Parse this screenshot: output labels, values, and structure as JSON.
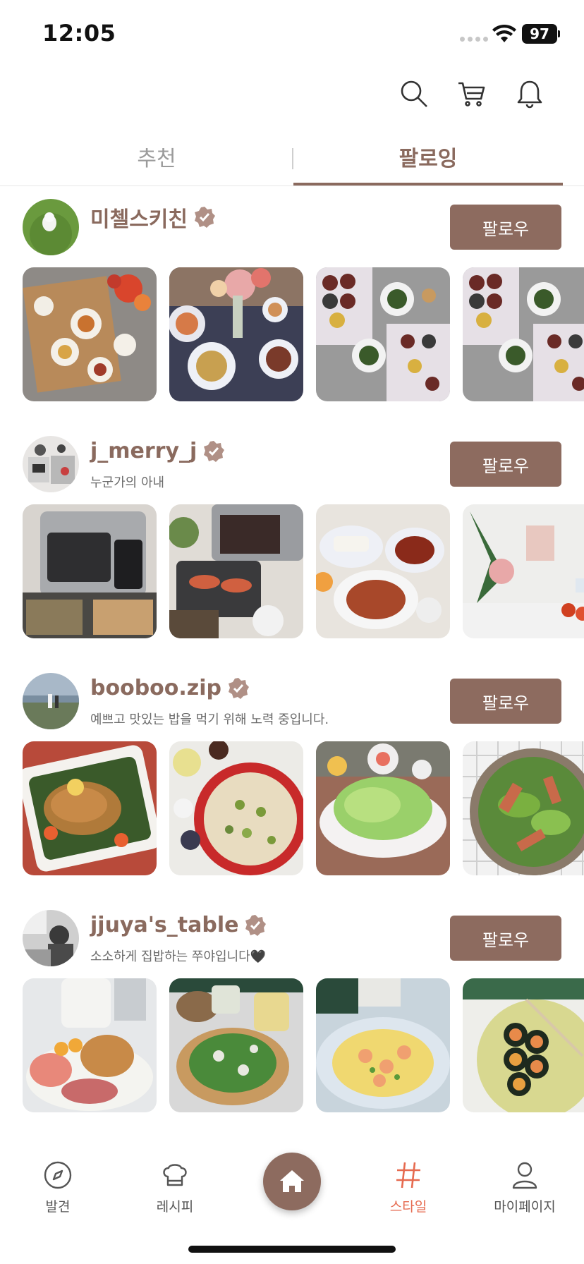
{
  "status": {
    "time": "12:05",
    "battery": "97"
  },
  "tabs": {
    "recommend": "추천",
    "following": "팔로잉"
  },
  "creators": [
    {
      "name": "미첼스키친",
      "bio": "",
      "follow_label": "팔로우"
    },
    {
      "name": "j_merry_j",
      "bio": "누군가의 아내",
      "follow_label": "팔로우"
    },
    {
      "name": "booboo.zip",
      "bio": "예쁘고 맛있는 밥을 먹기 위해 노력 중입니다.",
      "follow_label": "팔로우"
    },
    {
      "name": "jjuya's_table",
      "bio": "소소하게 집밥하는 쭈야입니다🖤",
      "follow_label": "팔로우"
    }
  ],
  "nav": {
    "discover": "발견",
    "recipe": "레시피",
    "style": "스타일",
    "mypage": "마이페이지"
  },
  "colors": {
    "accent": "#8d6b5f",
    "active_nav": "#e66a4f"
  },
  "icons": [
    "search-icon",
    "cart-icon",
    "bell-icon",
    "verified-icon",
    "compass-icon",
    "chef-hat-icon",
    "home-icon",
    "hashtag-icon",
    "person-icon"
  ]
}
